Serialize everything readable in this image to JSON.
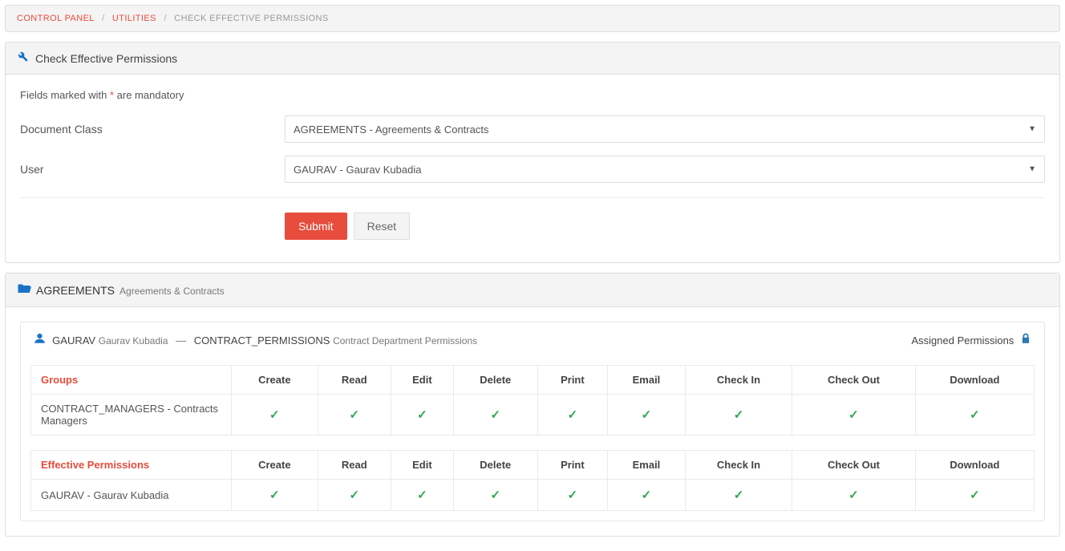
{
  "breadcrumb": {
    "control_panel": "CONTROL PANEL",
    "utilities": "UTILITIES",
    "current": "CHECK EFFECTIVE PERMISSIONS"
  },
  "form_panel": {
    "title": "Check Effective Permissions",
    "mandatory_prefix": "Fields marked with ",
    "mandatory_star": "*",
    "mandatory_suffix": " are mandatory",
    "doc_class_label": "Document Class",
    "doc_class_value": "AGREEMENTS - Agreements & Contracts",
    "user_label": "User",
    "user_value": "GAURAV - Gaurav Kubadia",
    "submit": "Submit",
    "reset": "Reset"
  },
  "results": {
    "class_code": "AGREEMENTS",
    "class_name": "Agreements & Contracts",
    "user_code": "GAURAV",
    "user_name": "Gaurav Kubadia",
    "role_code": "CONTRACT_PERMISSIONS",
    "role_name": "Contract Department Permissions",
    "assigned_label": "Assigned Permissions",
    "columns": [
      "Create",
      "Read",
      "Edit",
      "Delete",
      "Print",
      "Email",
      "Check In",
      "Check Out",
      "Download"
    ],
    "groups_header": "Groups",
    "groups_rows": [
      {
        "name": "CONTRACT_MANAGERS - Contracts Managers",
        "perms": [
          true,
          true,
          true,
          true,
          true,
          true,
          true,
          true,
          true
        ]
      }
    ],
    "effective_header": "Effective Permissions",
    "effective_rows": [
      {
        "name": "GAURAV - Gaurav Kubadia",
        "perms": [
          true,
          true,
          true,
          true,
          true,
          true,
          true,
          true,
          true
        ]
      }
    ]
  }
}
